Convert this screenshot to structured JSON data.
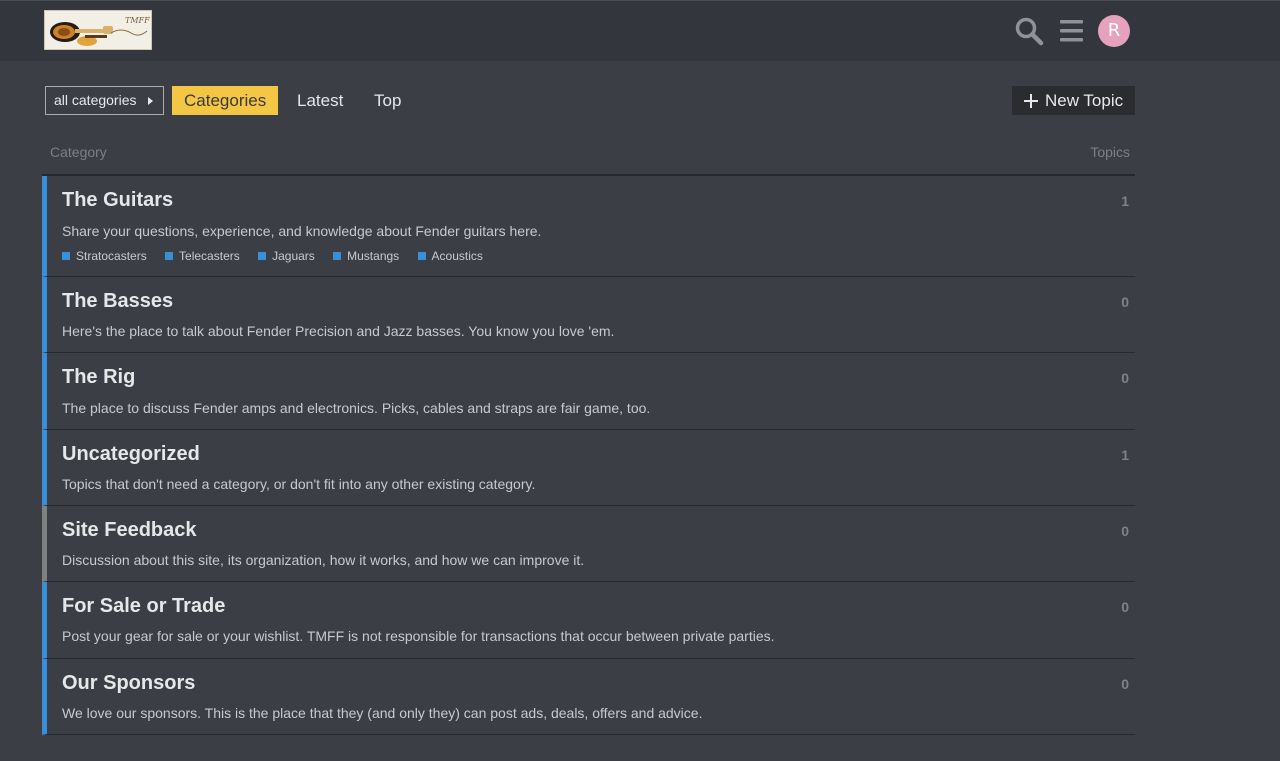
{
  "header": {
    "logo_label": "TMFF",
    "avatar_letter": "R"
  },
  "nav": {
    "category_dropdown": "all categories",
    "tabs": [
      {
        "label": "Categories",
        "active": true
      },
      {
        "label": "Latest",
        "active": false
      },
      {
        "label": "Top",
        "active": false
      }
    ],
    "new_topic_label": "New Topic"
  },
  "table": {
    "col_category": "Category",
    "col_topics": "Topics"
  },
  "categories": [
    {
      "name": "The Guitars",
      "description": "Share your questions, experience, and knowledge about Fender guitars here.",
      "topics": "1",
      "color": "#3a8fd9",
      "subcategories": [
        "Stratocasters",
        "Telecasters",
        "Jaguars",
        "Mustangs",
        "Acoustics"
      ]
    },
    {
      "name": "The Basses",
      "description": "Here's the place to talk about Fender Precision and Jazz basses. You know you love 'em.",
      "topics": "0",
      "color": "#3a8fd9"
    },
    {
      "name": "The Rig",
      "description": "The place to discuss Fender amps and electronics. Picks, cables and straps are fair game, too.",
      "topics": "0",
      "color": "#3a8fd9"
    },
    {
      "name": "Uncategorized",
      "description": "Topics that don't need a category, or don't fit into any other existing category.",
      "topics": "1",
      "color": "#3a8fd9"
    },
    {
      "name": "Site Feedback",
      "description": "Discussion about this site, its organization, how it works, and how we can improve it.",
      "topics": "0",
      "color": "#808281"
    },
    {
      "name": "For Sale or Trade",
      "description": "Post your gear for sale or your wishlist. TMFF is not responsible for transactions that occur between private parties.",
      "topics": "0",
      "color": "#3a8fd9"
    },
    {
      "name": "Our Sponsors",
      "description": "We love our sponsors. This is the place that they (and only they) can post ads, deals, offers and advice.",
      "topics": "0",
      "color": "#3a8fd9"
    }
  ]
}
